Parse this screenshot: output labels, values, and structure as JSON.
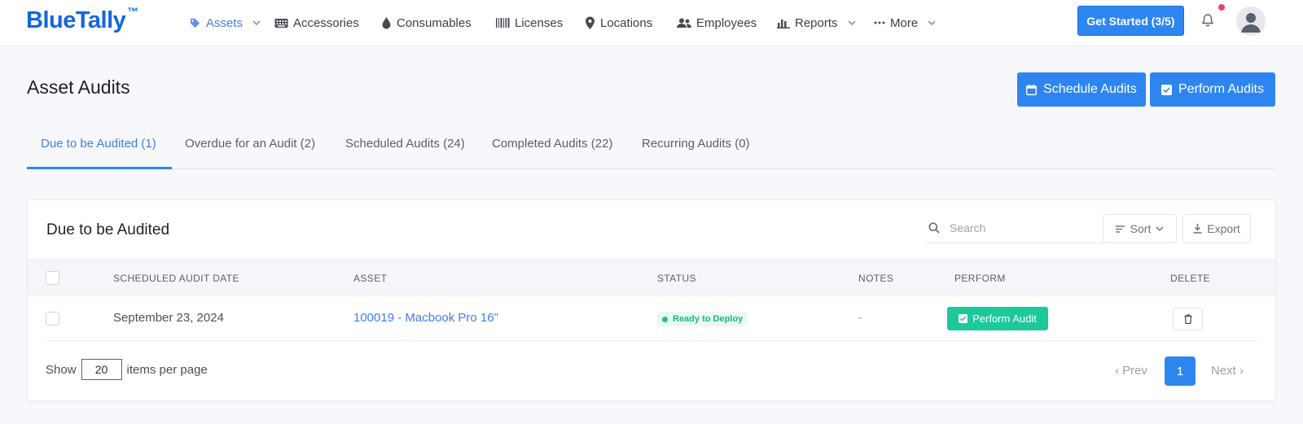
{
  "brand": {
    "name": "BlueTally",
    "tm": "™"
  },
  "nav": {
    "items": [
      {
        "label": "Assets",
        "icon": "tag-icon",
        "active": true,
        "dropdown": true
      },
      {
        "label": "Accessories",
        "icon": "keyboard-icon"
      },
      {
        "label": "Consumables",
        "icon": "drop-icon"
      },
      {
        "label": "Licenses",
        "icon": "barcode-icon"
      },
      {
        "label": "Locations",
        "icon": "location-pin-icon"
      },
      {
        "label": "Employees",
        "icon": "users-icon"
      },
      {
        "label": "Reports",
        "icon": "bar-chart-icon",
        "dropdown": true
      },
      {
        "label": "More",
        "icon": "more-dots-icon",
        "dropdown": true
      }
    ],
    "get_started": "Get Started (3/5)"
  },
  "page": {
    "title": "Asset Audits",
    "schedule_button": "Schedule Audits",
    "perform_button": "Perform Audits"
  },
  "tabs": [
    {
      "label": "Due to be Audited (1)",
      "active": true
    },
    {
      "label": "Overdue for an Audit (2)"
    },
    {
      "label": "Scheduled Audits (24)"
    },
    {
      "label": "Completed Audits (22)"
    },
    {
      "label": "Recurring Audits (0)"
    }
  ],
  "card": {
    "title": "Due to be Audited",
    "search_placeholder": "Search",
    "sort_label": "Sort",
    "export_label": "Export",
    "columns": [
      "SCHEDULED AUDIT DATE",
      "ASSET",
      "STATUS",
      "NOTES",
      "PERFORM",
      "DELETE"
    ],
    "rows": [
      {
        "date": "September 23, 2024",
        "asset": "100019 - Macbook Pro 16\"",
        "status": "Ready to Deploy",
        "notes": "-",
        "perform": "Perform Audit"
      }
    ],
    "show_label": "Show",
    "per_page_value": "20",
    "per_page_suffix": "items per page",
    "prev_label": "‹ Prev",
    "current_page": "1",
    "next_label": "Next ›"
  },
  "colors": {
    "brand": "#1565e0",
    "primary": "#2d86f0",
    "success": "#1cc99a",
    "notification_dot": "#e8436a"
  }
}
